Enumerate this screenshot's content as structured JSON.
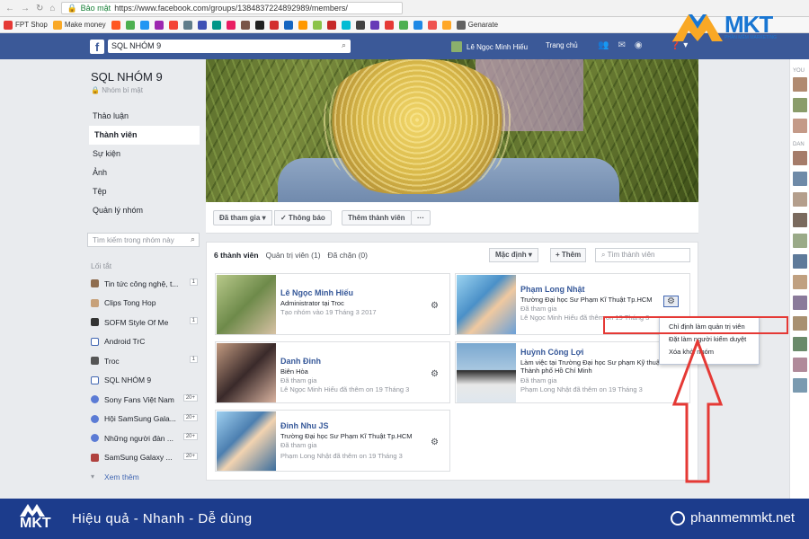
{
  "browser": {
    "secure_label": "Bảo mật",
    "url": "https://www.facebook.com/groups/1384837224892989/members/"
  },
  "bookmarks": [
    {
      "label": "FPT Shop",
      "color": "#e53935"
    },
    {
      "label": "Make money",
      "color": "#f9a825"
    },
    {
      "label": "Genarate",
      "color": "#616161"
    }
  ],
  "fb_header": {
    "logo": "f",
    "search_value": "SQL NHÓM 9",
    "user_name": "Lê Ngọc Minh Hiếu",
    "home_label": "Trang chủ",
    "accent": "#3b5998"
  },
  "brand_logo": {
    "word": "MKT",
    "tag": "PHẦN MỀM MARKETING"
  },
  "group": {
    "name": "SQL NHÓM 9",
    "privacy": "Nhóm bí mật"
  },
  "nav": [
    {
      "label": "Thảo luận"
    },
    {
      "label": "Thành viên"
    },
    {
      "label": "Sự kiện"
    },
    {
      "label": "Ảnh"
    },
    {
      "label": "Tệp"
    },
    {
      "label": "Quản lý nhóm"
    }
  ],
  "left_search_placeholder": "Tìm kiếm trong nhóm này",
  "shortcuts_title": "Lối tắt",
  "shortcuts": [
    {
      "label": "Tin tức công nghệ, t...",
      "count": "1",
      "color": "#8e6d4f"
    },
    {
      "label": "Clips Tong Hop",
      "count": "",
      "color": "#c7a17a"
    },
    {
      "label": "SOFM Style Of Me",
      "count": "1",
      "color": "#333333"
    },
    {
      "label": "Android TrC",
      "count": "",
      "color": "#4267b2"
    },
    {
      "label": "Troc",
      "count": "1",
      "color": "#555555"
    },
    {
      "label": "SQL NHÓM 9",
      "count": "",
      "color": "#4267b2"
    },
    {
      "label": "Sony Fans Việt Nam",
      "count": "20+",
      "color": "#5b7bd5"
    },
    {
      "label": "Hội SamSung Gala...",
      "count": "20+",
      "color": "#5b7bd5"
    },
    {
      "label": "Những người đàn ...",
      "count": "20+",
      "color": "#5b7bd5"
    },
    {
      "label": "SamSung Galaxy ...",
      "count": "20+",
      "color": "#b0413e"
    },
    {
      "label": "Xem thêm",
      "count": "",
      "color": "#90949c"
    }
  ],
  "actions": {
    "joined": "Đã tham gia ▾",
    "notify": "✓ Thông báo",
    "add_member": "Thêm thành viên",
    "more": "···"
  },
  "members_panel": {
    "tabs": [
      {
        "label": "6 thành viên"
      },
      {
        "label": "Quản trị viên (1)"
      },
      {
        "label": "Đã chặn (0)"
      }
    ],
    "sort": "Mặc định ▾",
    "add": "+ Thêm",
    "search_placeholder": "Tìm thành viên"
  },
  "members": [
    {
      "name": "Lê Ngọc Minh Hiếu",
      "line1": "Administrator tại Troc",
      "line2": "Tạo nhóm vào 19 Tháng 3 2017",
      "line3": ""
    },
    {
      "name": "Phạm Long Nhật",
      "line1": "Trường Đại học Sư Phạm Kĩ Thuật Tp.HCM",
      "line2": "Đã tham gia",
      "line3": "Lê Ngọc Minh Hiếu đã thêm on 19 Tháng 3"
    },
    {
      "name": "Danh Đinh",
      "line1": "Biên Hòa",
      "line2": "Đã tham gia",
      "line3": "Lê Ngọc Minh Hiếu đã thêm on 19 Tháng 3"
    },
    {
      "name": "Huỳnh Công Lợi",
      "line1": "Làm việc tại Trường Đại học Sư phạm Kỹ thuật Thành phố Hồ Chí Minh",
      "line2": "Đã tham gia",
      "line3": "Phạm Long Nhật đã thêm on 19 Tháng 3"
    },
    {
      "name": "Đinh Nhu JS",
      "line1": "Trường Đại học Sư Phạm Kĩ Thuật Tp.HCM",
      "line2": "Đã tham gia",
      "line3": "Phạm Long Nhật đã thêm on 19 Tháng 3"
    }
  ],
  "dropdown": [
    {
      "label": "Chỉ định làm quản trị viên"
    },
    {
      "label": "Đặt làm người kiểm duyệt"
    },
    {
      "label": "Xóa khỏi nhóm"
    }
  ],
  "right_col": {
    "h1": "YOU",
    "h2": "DAN"
  },
  "footer": {
    "logo": "MKT",
    "slogan": "Hiệu quả - Nhanh  - Dễ dùng",
    "site": "phanmemmkt.net"
  }
}
